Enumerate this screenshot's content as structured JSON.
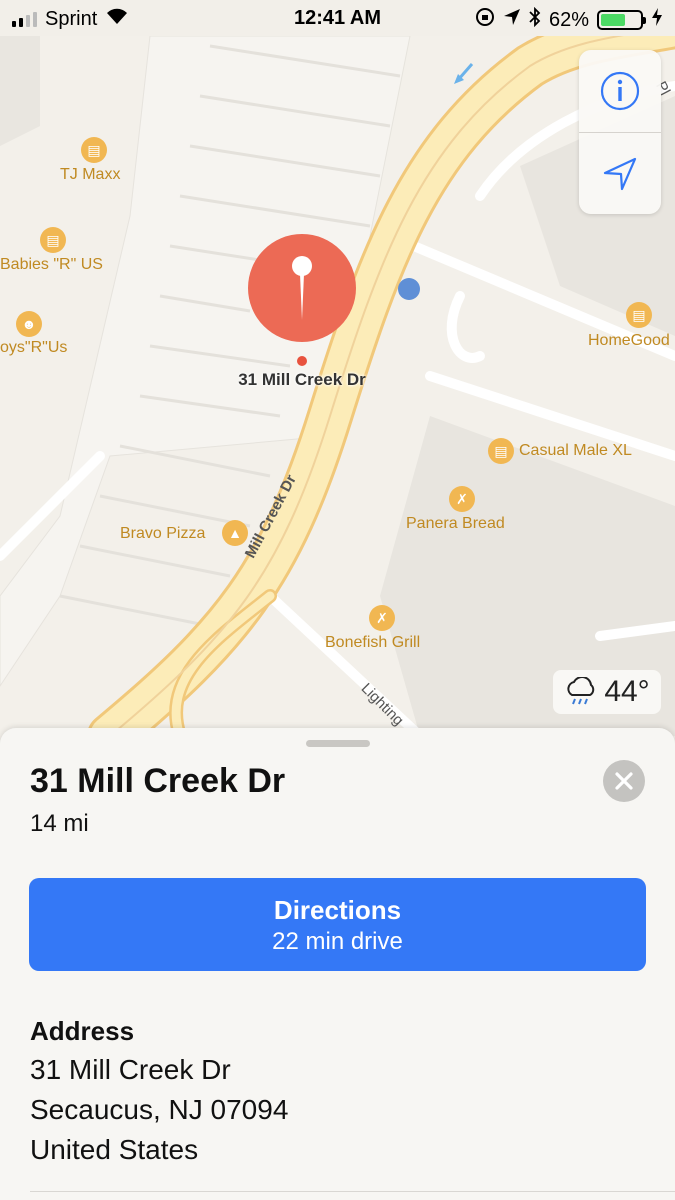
{
  "status_bar": {
    "carrier": "Sprint",
    "time": "12:41 AM",
    "battery_percent": "62%",
    "battery_level": 0.62
  },
  "map": {
    "pin_label": "31 Mill Creek Dr",
    "street_labels": [
      "Mill Creek Dr",
      "Lighting",
      "Pl"
    ],
    "pois": [
      {
        "name": "TJ Maxx",
        "icon": "shopping-bag-icon"
      },
      {
        "name": "Babies \"R\" US",
        "icon": "shopping-bag-icon"
      },
      {
        "name": "oys\"R\"Us",
        "icon": "toy-icon"
      },
      {
        "name": "HomeGood",
        "icon": "shopping-bag-icon"
      },
      {
        "name": "Casual Male XL",
        "icon": "shopping-bag-icon"
      },
      {
        "name": "Panera Bread",
        "icon": "fork-knife-icon"
      },
      {
        "name": "Bravo Pizza",
        "icon": "pizza-icon"
      },
      {
        "name": "Bonefish Grill",
        "icon": "fork-knife-icon"
      }
    ],
    "weather": {
      "temperature": "44°",
      "icon": "cloud-rain-icon"
    }
  },
  "sheet": {
    "title": "31 Mill Creek Dr",
    "distance": "14 mi",
    "directions_label": "Directions",
    "directions_sub": "22 min drive",
    "address_heading": "Address",
    "address_lines": [
      "31 Mill Creek Dr",
      "Secaucus, NJ  07094",
      "United States"
    ]
  },
  "colors": {
    "accent": "#3478f6",
    "pin": "#ec6a55",
    "poi": "#f1b752",
    "road": "#fbe7a8"
  }
}
